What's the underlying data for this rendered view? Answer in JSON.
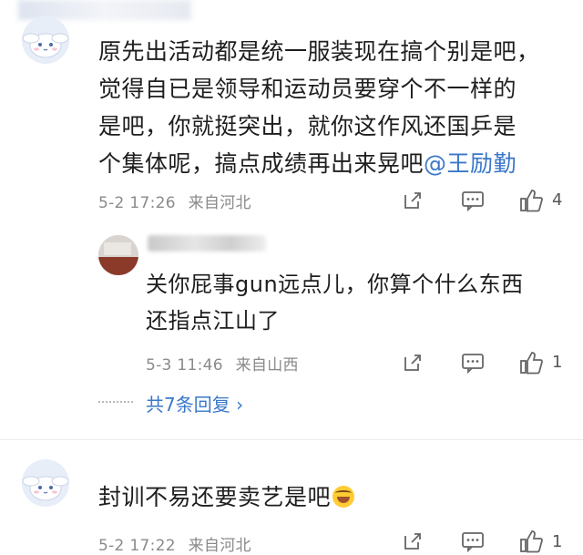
{
  "comments": [
    {
      "text_lines": [
        "原先出活动都是统一服装现在搞个别是吧，",
        "觉得自已是领导和运动员要穿个不一样的",
        "是吧，你就挺突出，就你这作风还国乒是",
        "个集体呢，搞点成绩再出来晃吧"
      ],
      "mention": "@王励勤",
      "date": "5-2 17:26",
      "location": "来自河北",
      "like_count": "4",
      "replies": [
        {
          "text_lines": [
            "关你屁事gun远点儿，你算个什么东西",
            "还指点江山了"
          ],
          "date": "5-3 11:46",
          "location": "来自山西",
          "like_count": "1"
        }
      ],
      "more_replies_label": "共7条回复 ›"
    },
    {
      "text": "封训不易还要卖艺是吧",
      "emoji": "laughing-crying-emoji",
      "date": "5-2 17:22",
      "location": "来自河北",
      "like_count": "1"
    }
  ],
  "icons": {
    "share": "share-icon",
    "comment": "comment-icon",
    "like": "thumbs-up-icon"
  },
  "colors": {
    "link": "#3a78c8",
    "meta": "#8a8a8a",
    "text": "#1e1e1e"
  }
}
